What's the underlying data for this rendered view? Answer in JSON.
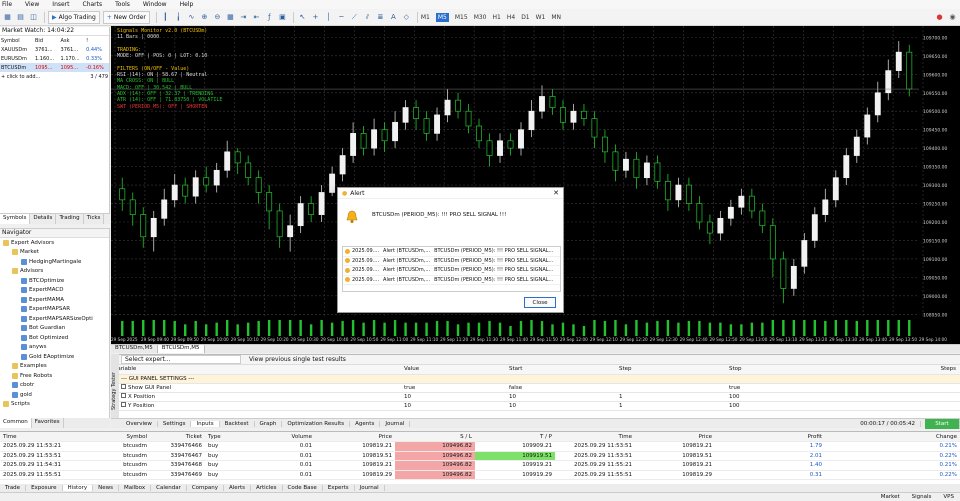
{
  "menu": [
    "File",
    "View",
    "Insert",
    "Charts",
    "Tools",
    "Window",
    "Help"
  ],
  "toolbar": {
    "algo_trading": "Algo Trading",
    "new_order": "New Order",
    "timeframes": [
      "M1",
      "M5",
      "M15",
      "M30",
      "H1",
      "H4",
      "D1",
      "W1",
      "MN"
    ],
    "selected_tf": "M5"
  },
  "market_watch": {
    "title": "Market Watch: 14:04:22",
    "headers": [
      "Symbol",
      "Bid",
      "Ask",
      "!"
    ],
    "rows": [
      {
        "symbol": "XAUUSDm",
        "bid": "3761...",
        "ask": "3761...",
        "change": "0.44%"
      },
      {
        "symbol": "EURUSDm",
        "bid": "1.160...",
        "ask": "1.170...",
        "change": "0.33%"
      },
      {
        "symbol": "BTCUSDm",
        "bid": "1095...",
        "ask": "1095...",
        "change": "-0.16%"
      }
    ],
    "footer_left": "+ click to add...",
    "footer_right": "3 / 479"
  },
  "mw_tabs": [
    "Symbols",
    "Details",
    "Trading",
    "Ticks"
  ],
  "navigator": {
    "title": "Navigator",
    "items": [
      {
        "label": "Expert Advisors",
        "depth": 0,
        "folder": true
      },
      {
        "label": "Market",
        "depth": 1,
        "folder": true
      },
      {
        "label": "HedgingMartingale",
        "depth": 2,
        "folder": false
      },
      {
        "label": "Advisors",
        "depth": 1,
        "folder": true
      },
      {
        "label": "BTCOptimize",
        "depth": 2,
        "folder": false
      },
      {
        "label": "ExpertMACD",
        "depth": 2,
        "folder": false
      },
      {
        "label": "ExpertMAMA",
        "depth": 2,
        "folder": false
      },
      {
        "label": "ExpertMAPSAR",
        "depth": 2,
        "folder": false
      },
      {
        "label": "ExpertMAPSARSizeOpti",
        "depth": 2,
        "folder": false
      },
      {
        "label": "Bot Guardian",
        "depth": 2,
        "folder": false
      },
      {
        "label": "Bot Optimized",
        "depth": 2,
        "folder": false
      },
      {
        "label": "anyws",
        "depth": 2,
        "folder": false
      },
      {
        "label": "Gold EAoptimize",
        "depth": 2,
        "folder": false
      },
      {
        "label": "Examples",
        "depth": 1,
        "folder": true
      },
      {
        "label": "Free Robots",
        "depth": 1,
        "folder": true
      },
      {
        "label": "cbotr",
        "depth": 1,
        "folder": false
      },
      {
        "label": "gold",
        "depth": 1,
        "folder": false
      },
      {
        "label": "Scripts",
        "depth": 0,
        "folder": true
      }
    ]
  },
  "nav_tabs": [
    "Common",
    "Favorites"
  ],
  "chart": {
    "overlay_lines": [
      {
        "text": "Signals Monitor v2.0 (BTCUSDm)",
        "cls": "y"
      },
      {
        "text": "11 Bars | 0000",
        "cls": ""
      },
      {
        "text": "",
        "cls": ""
      },
      {
        "text": "TRADING:",
        "cls": "y"
      },
      {
        "text": "MODE: OFF | POS: 0 | LOT: 0.10",
        "cls": ""
      },
      {
        "text": "",
        "cls": ""
      },
      {
        "text": "FILTERS (ON/OFF - Value)",
        "cls": "y"
      },
      {
        "text": "RSI (14): ON | 58.67 | Neutral",
        "cls": ""
      },
      {
        "text": "MA CROSS: ON | BULL",
        "cls": "g"
      },
      {
        "text": "MACD: OFF | 30.542 | BULL",
        "cls": "g"
      },
      {
        "text": "ADX (14): OFF | 32.37 | TRENDING",
        "cls": "g"
      },
      {
        "text": "ATR (14): OFF | 71.83750 | VOLATILE",
        "cls": "g"
      },
      {
        "text": "SWT (PERIOD_M5): OFF | SHORTEN",
        "cls": "r"
      }
    ],
    "price_labels": [
      "109700.00",
      "109650.00",
      "109600.00",
      "109550.00",
      "109500.00",
      "109450.00",
      "109400.00",
      "109350.00",
      "109300.00",
      "109250.00",
      "109200.00",
      "109150.00",
      "109100.00",
      "109050.00",
      "109000.00",
      "108950.00"
    ],
    "time_labels": [
      "29 Sep 2025",
      "29 Sep 09:40",
      "29 Sep 09:50",
      "29 Sep 10:00",
      "29 Sep 10:10",
      "29 Sep 10:20",
      "29 Sep 10:30",
      "29 Sep 10:40",
      "29 Sep 10:50",
      "29 Sep 11:00",
      "29 Sep 11:10",
      "29 Sep 11:20",
      "29 Sep 11:30",
      "29 Sep 11:40",
      "29 Sep 11:50",
      "29 Sep 12:00",
      "29 Sep 12:10",
      "29 Sep 12:20",
      "29 Sep 12:30",
      "29 Sep 12:40",
      "29 Sep 12:50",
      "29 Sep 13:00",
      "29 Sep 13:10",
      "29 Sep 13:20",
      "29 Sep 13:30",
      "29 Sep 13:40",
      "29 Sep 13:50",
      "29 Sep 14:00"
    ],
    "candles": [
      {
        "o": 109290,
        "c": 109260,
        "h": 109320,
        "l": 109230
      },
      {
        "o": 109260,
        "c": 109220,
        "h": 109280,
        "l": 109190
      },
      {
        "o": 109220,
        "c": 109160,
        "h": 109240,
        "l": 109130
      },
      {
        "o": 109160,
        "c": 109210,
        "h": 109230,
        "l": 109120
      },
      {
        "o": 109210,
        "c": 109260,
        "h": 109290,
        "l": 109190
      },
      {
        "o": 109260,
        "c": 109300,
        "h": 109330,
        "l": 109240
      },
      {
        "o": 109300,
        "c": 109270,
        "h": 109320,
        "l": 109250
      },
      {
        "o": 109270,
        "c": 109320,
        "h": 109340,
        "l": 109250
      },
      {
        "o": 109320,
        "c": 109300,
        "h": 109350,
        "l": 109280
      },
      {
        "o": 109300,
        "c": 109340,
        "h": 109360,
        "l": 109280
      },
      {
        "o": 109340,
        "c": 109390,
        "h": 109420,
        "l": 109320
      },
      {
        "o": 109390,
        "c": 109360,
        "h": 109400,
        "l": 109330
      },
      {
        "o": 109360,
        "c": 109320,
        "h": 109380,
        "l": 109300
      },
      {
        "o": 109320,
        "c": 109280,
        "h": 109340,
        "l": 109250
      },
      {
        "o": 109280,
        "c": 109230,
        "h": 109300,
        "l": 109180
      },
      {
        "o": 109230,
        "c": 109160,
        "h": 109250,
        "l": 109130
      },
      {
        "o": 109160,
        "c": 109190,
        "h": 109220,
        "l": 109120
      },
      {
        "o": 109190,
        "c": 109250,
        "h": 109270,
        "l": 109170
      },
      {
        "o": 109250,
        "c": 109220,
        "h": 109270,
        "l": 109200
      },
      {
        "o": 109220,
        "c": 109280,
        "h": 109300,
        "l": 109200
      },
      {
        "o": 109280,
        "c": 109330,
        "h": 109350,
        "l": 109270
      },
      {
        "o": 109330,
        "c": 109380,
        "h": 109400,
        "l": 109310
      },
      {
        "o": 109380,
        "c": 109440,
        "h": 109470,
        "l": 109360
      },
      {
        "o": 109440,
        "c": 109400,
        "h": 109460,
        "l": 109380
      },
      {
        "o": 109400,
        "c": 109450,
        "h": 109480,
        "l": 109380
      },
      {
        "o": 109450,
        "c": 109420,
        "h": 109470,
        "l": 109390
      },
      {
        "o": 109420,
        "c": 109470,
        "h": 109500,
        "l": 109400
      },
      {
        "o": 109470,
        "c": 109510,
        "h": 109530,
        "l": 109450
      },
      {
        "o": 109510,
        "c": 109480,
        "h": 109530,
        "l": 109450
      },
      {
        "o": 109480,
        "c": 109440,
        "h": 109500,
        "l": 109420
      },
      {
        "o": 109440,
        "c": 109490,
        "h": 109510,
        "l": 109420
      },
      {
        "o": 109490,
        "c": 109530,
        "h": 109560,
        "l": 109470
      },
      {
        "o": 109530,
        "c": 109500,
        "h": 109550,
        "l": 109480
      },
      {
        "o": 109500,
        "c": 109460,
        "h": 109520,
        "l": 109440
      },
      {
        "o": 109460,
        "c": 109420,
        "h": 109480,
        "l": 109400
      },
      {
        "o": 109420,
        "c": 109380,
        "h": 109440,
        "l": 109350
      },
      {
        "o": 109380,
        "c": 109420,
        "h": 109440,
        "l": 109360
      },
      {
        "o": 109420,
        "c": 109400,
        "h": 109440,
        "l": 109380
      },
      {
        "o": 109400,
        "c": 109450,
        "h": 109470,
        "l": 109380
      },
      {
        "o": 109450,
        "c": 109500,
        "h": 109530,
        "l": 109430
      },
      {
        "o": 109500,
        "c": 109540,
        "h": 109570,
        "l": 109480
      },
      {
        "o": 109540,
        "c": 109510,
        "h": 109560,
        "l": 109490
      },
      {
        "o": 109510,
        "c": 109470,
        "h": 109530,
        "l": 109450
      },
      {
        "o": 109470,
        "c": 109500,
        "h": 109520,
        "l": 109450
      },
      {
        "o": 109500,
        "c": 109480,
        "h": 109520,
        "l": 109460
      },
      {
        "o": 109480,
        "c": 109430,
        "h": 109500,
        "l": 109400
      },
      {
        "o": 109430,
        "c": 109390,
        "h": 109450,
        "l": 109360
      },
      {
        "o": 109390,
        "c": 109340,
        "h": 109410,
        "l": 109310
      },
      {
        "o": 109340,
        "c": 109370,
        "h": 109390,
        "l": 109320
      },
      {
        "o": 109370,
        "c": 109320,
        "h": 109390,
        "l": 109290
      },
      {
        "o": 109320,
        "c": 109360,
        "h": 109380,
        "l": 109300
      },
      {
        "o": 109360,
        "c": 109310,
        "h": 109380,
        "l": 109290
      },
      {
        "o": 109310,
        "c": 109260,
        "h": 109330,
        "l": 109230
      },
      {
        "o": 109260,
        "c": 109300,
        "h": 109320,
        "l": 109240
      },
      {
        "o": 109300,
        "c": 109250,
        "h": 109320,
        "l": 109230
      },
      {
        "o": 109250,
        "c": 109200,
        "h": 109270,
        "l": 109180
      },
      {
        "o": 109200,
        "c": 109170,
        "h": 109220,
        "l": 109140
      },
      {
        "o": 109170,
        "c": 109210,
        "h": 109230,
        "l": 109150
      },
      {
        "o": 109210,
        "c": 109240,
        "h": 109260,
        "l": 109190
      },
      {
        "o": 109240,
        "c": 109270,
        "h": 109290,
        "l": 109220
      },
      {
        "o": 109270,
        "c": 109230,
        "h": 109290,
        "l": 109210
      },
      {
        "o": 109230,
        "c": 109190,
        "h": 109250,
        "l": 109170
      },
      {
        "o": 109190,
        "c": 109100,
        "h": 109210,
        "l": 109050
      },
      {
        "o": 109100,
        "c": 109020,
        "h": 109120,
        "l": 108980
      },
      {
        "o": 109020,
        "c": 109080,
        "h": 109100,
        "l": 109000
      },
      {
        "o": 109080,
        "c": 109150,
        "h": 109170,
        "l": 109060
      },
      {
        "o": 109150,
        "c": 109220,
        "h": 109240,
        "l": 109130
      },
      {
        "o": 109220,
        "c": 109260,
        "h": 109290,
        "l": 109200
      },
      {
        "o": 109260,
        "c": 109320,
        "h": 109340,
        "l": 109240
      },
      {
        "o": 109320,
        "c": 109380,
        "h": 109400,
        "l": 109300
      },
      {
        "o": 109380,
        "c": 109430,
        "h": 109450,
        "l": 109360
      },
      {
        "o": 109430,
        "c": 109490,
        "h": 109510,
        "l": 109410
      },
      {
        "o": 109490,
        "c": 109550,
        "h": 109580,
        "l": 109470
      },
      {
        "o": 109550,
        "c": 109610,
        "h": 109640,
        "l": 109530
      },
      {
        "o": 109610,
        "c": 109660,
        "h": 109690,
        "l": 109590
      },
      {
        "o": 109660,
        "c": 109560,
        "h": 109680,
        "l": 109540
      }
    ]
  },
  "chart_tabs": [
    "BTCUSDm,M5",
    "BTCUSDm,M5"
  ],
  "strategy_tester": {
    "select_expert": "Select expert...",
    "view_label": "View previous single test results",
    "headers": [
      "Variable",
      "Value",
      "Start",
      "Step",
      "Stop",
      "Steps"
    ],
    "group": "--- GUI PANEL SETTINGS ---",
    "rows": [
      {
        "var": "Show GUI Panel",
        "value": "true",
        "start": "false",
        "step": "",
        "stop": "true"
      },
      {
        "var": "X Position",
        "value": "10",
        "start": "10",
        "step": "1",
        "stop": "100"
      },
      {
        "var": "Y Position",
        "value": "10",
        "start": "10",
        "step": "1",
        "stop": "100"
      }
    ],
    "tabs": [
      "Overview",
      "Settings",
      "Inputs",
      "Backtest",
      "Graph",
      "Optimization Results",
      "Agents",
      "Journal"
    ],
    "active_tab": "Inputs",
    "timer": "00:00:17 / 00:05:42",
    "start": "Start",
    "side_label": "Strategy Tester"
  },
  "trade_table": {
    "headers": [
      "Time",
      "Symbol",
      "Ticket",
      "Type",
      "Volume",
      "Price",
      "S / L",
      "T / P",
      "Time",
      "Price",
      "Profit",
      "Change"
    ],
    "rows": [
      {
        "time": "2025.09.29 11:53:21",
        "symbol": "btcusdm",
        "ticket": "339476466",
        "type": "buy",
        "volume": "0.01",
        "price": "109819.21",
        "sl": "109496.82",
        "tp": "109909.21",
        "time2": "2025.09.29 11:53:51",
        "price2": "109819.21",
        "profit": "1.79",
        "change": "0.21%"
      },
      {
        "time": "2025.09.29 11:53:51",
        "symbol": "btcusdm",
        "ticket": "339476467",
        "type": "buy",
        "volume": "0.01",
        "price": "109819.51",
        "sl": "109496.82",
        "tp": "109919.51",
        "time2": "2025.09.29 11:53:51",
        "price2": "109819.51",
        "profit": "2.01",
        "change": "0.22%"
      },
      {
        "time": "2025.09.29 11:54:31",
        "symbol": "btcusdm",
        "ticket": "339476468",
        "type": "buy",
        "volume": "0.01",
        "price": "109819.21",
        "sl": "109496.82",
        "tp": "109919.21",
        "time2": "2025.09.29 11:55:21",
        "price2": "109819.21",
        "profit": "1.40",
        "change": "0.21%"
      },
      {
        "time": "2025.09.29 11:55:51",
        "symbol": "btcusdm",
        "ticket": "339476469",
        "type": "buy",
        "volume": "0.01",
        "price": "109819.29",
        "sl": "109496.82",
        "tp": "109919.29",
        "time2": "2025.09.29 11:55:51",
        "price2": "109819.29",
        "profit": "0.31",
        "change": "0.22%"
      }
    ]
  },
  "bottom_tabs": [
    "Trade",
    "Exposure",
    "History",
    "News",
    "Mailbox",
    "Calendar",
    "Company",
    "Alerts",
    "Articles",
    "Code Base",
    "Experts",
    "Journal"
  ],
  "active_bottom_tab": "History",
  "status": [
    "Market",
    "Signals",
    "VPS"
  ],
  "alert": {
    "title": "Alert",
    "message": "BTCUSDm (PERIOD_M5): !!! PRO SELL SIGNAL !!!",
    "rows": [
      {
        "date": "2025.09....",
        "src": "Alert (BTCUSDm,...",
        "msg": "BTCUSDm (PERIOD_M5): !!! PRO SELL SIGNAL..."
      },
      {
        "date": "2025.09....",
        "src": "Alert (BTCUSDm,...",
        "msg": "BTCUSDm (PERIOD_M5): !!! PRO SELL SIGNAL..."
      },
      {
        "date": "2025.09....",
        "src": "Alert (BTCUSDm,...",
        "msg": "BTCUSDm (PERIOD_M5): !!! PRO SELL SIGNAL..."
      },
      {
        "date": "2025.09....",
        "src": "Alert (BTCUSDm,...",
        "msg": "BTCUSDm (PERIOD_M5): !!! PRO SELL SIGNAL..."
      }
    ],
    "close": "Close"
  }
}
